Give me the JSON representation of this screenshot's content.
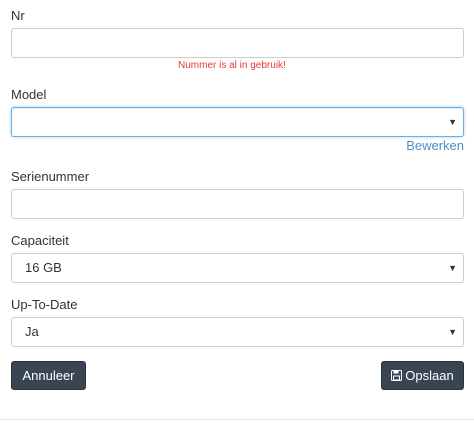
{
  "form": {
    "nr": {
      "label": "Nr",
      "value": "",
      "error": "Nummer is al in gebruik!"
    },
    "model": {
      "label": "Model",
      "value": "",
      "edit_link": "Bewerken"
    },
    "serienummer": {
      "label": "Serienummer",
      "value": ""
    },
    "capaciteit": {
      "label": "Capaciteit",
      "value": "16 GB"
    },
    "up_to_date": {
      "label": "Up-To-Date",
      "value": "Ja"
    }
  },
  "actions": {
    "cancel_label": "Annuleer",
    "save_label": "Opslaan",
    "save_icon": "floppy-disk-icon"
  },
  "colors": {
    "button_bg": "#3a4553",
    "error": "#e8393a",
    "link": "#4a90c9",
    "focus_border": "#66afe9"
  }
}
